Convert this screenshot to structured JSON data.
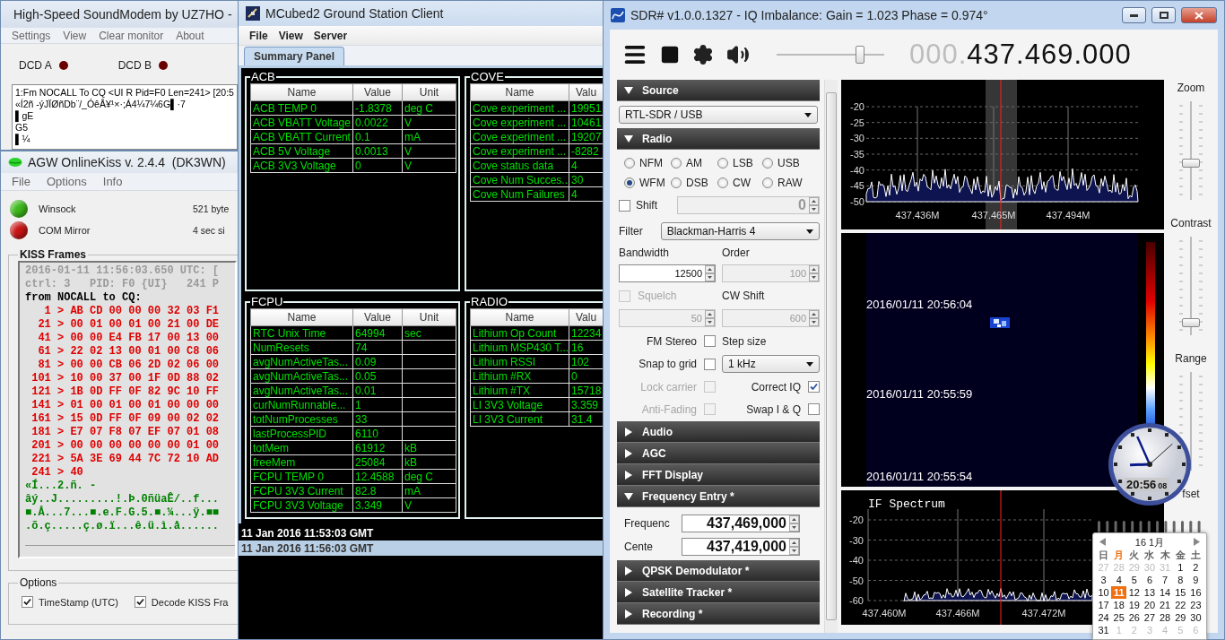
{
  "sound_modem": {
    "title": "High-Speed SoundModem by UZ7HO -",
    "menu": [
      "Settings",
      "View",
      "Clear monitor",
      "About"
    ],
    "dcd": [
      {
        "label": "DCD A",
        "on": false
      },
      {
        "label": "DCD B",
        "on": false
      }
    ],
    "monitor_lines": [
      "1:Fm NOCALL To CQ <UI R Pid=F0 Len=241> [20:5",
      "«Í2ñ -ýJÏØñDb¨/_ÓêÅ¥¹×·;Á4¼7¼6G▌·7",
      "▌gE",
      "G5",
      "▌¼"
    ]
  },
  "online_kiss": {
    "title": "AGW OnlineKiss v. 2.4.4  (DK3WN)",
    "menu": [
      "File",
      "Options",
      "Info"
    ],
    "status": [
      {
        "label": "Winsock",
        "color": "#3cb81a",
        "info": "521 byte"
      },
      {
        "label": "COM Mirror",
        "color": "#c81414",
        "info": "4 sec si"
      }
    ],
    "kiss_frames": {
      "title": "KISS Frames",
      "lines": [
        {
          "kind": "meta",
          "text": "2016-01-11 11:56:03.650 UTC: ["
        },
        {
          "kind": "meta",
          "text": "ctrl: 3   PID: F0 {UI}   241 P"
        },
        {
          "kind": "from",
          "text": "from NOCALL to CQ:"
        },
        {
          "kind": "hex",
          "text": "   1 > AB CD 00 00 00 32 03 F1"
        },
        {
          "kind": "hex",
          "text": "  21 > 00 01 00 01 00 21 00 DE"
        },
        {
          "kind": "hex",
          "text": "  41 > 00 00 E4 FB 17 00 13 00"
        },
        {
          "kind": "hex",
          "text": "  61 > 22 02 13 00 01 00 C8 06"
        },
        {
          "kind": "hex",
          "text": "  81 > 00 00 CB 06 2D 02 06 00"
        },
        {
          "kind": "hex",
          "text": " 101 > 10 00 37 00 1F 0D 88 02"
        },
        {
          "kind": "hex",
          "text": " 121 > 1B 0D FF 0F 82 9C 10 FF"
        },
        {
          "kind": "hex",
          "text": " 141 > 01 00 01 00 01 00 00 00"
        },
        {
          "kind": "hex",
          "text": " 161 > 15 0D FF 0F 09 00 02 02"
        },
        {
          "kind": "hex",
          "text": " 181 > E7 07 F8 07 EF 07 01 08"
        },
        {
          "kind": "hex",
          "text": " 201 > 00 00 00 00 00 00 01 00"
        },
        {
          "kind": "hex",
          "text": " 221 > 5A 3E 69 44 7C 72 10 AD"
        },
        {
          "kind": "hex",
          "text": " 241 > 40"
        },
        {
          "kind": "ascii",
          "text": "«Í...2.ñ. -"
        },
        {
          "kind": "ascii",
          "text": "âý..J.........!.Þ.0ñüaÊ/..f..."
        },
        {
          "kind": "ascii",
          "text": "■.Å...7...■.e.F.G.5.■.¼...ÿ.■■"
        },
        {
          "kind": "ascii",
          "text": ".õ.ç.....ç.ø.ï...ê.ü.ì.å......"
        }
      ]
    },
    "options": {
      "title": "Options",
      "checkboxes": [
        {
          "label": "TimeStamp (UTC)",
          "checked": true
        },
        {
          "label": "Decode KISS Fra",
          "checked": true
        }
      ]
    }
  },
  "mcubed": {
    "title": "MCubed2 Ground Station Client",
    "menu": [
      "File",
      "View",
      "Server"
    ],
    "tabs": [
      {
        "label": "Summary Panel",
        "selected": true
      }
    ],
    "panels": [
      {
        "title": "ACB",
        "columns": [
          "Name",
          "Value",
          "Unit"
        ],
        "rows": [
          {
            "name": "ACB TEMP 0",
            "value": "-1.8378",
            "unit": "deg C"
          },
          {
            "name": "ACB VBATT Voltage",
            "value": "0.0022",
            "unit": "V"
          },
          {
            "name": "ACB VBATT Current",
            "value": "0.1",
            "unit": "mA"
          },
          {
            "name": "ACB 5V Voltage",
            "value": "0.0013",
            "unit": "V"
          },
          {
            "name": "ACB 3V3 Voltage",
            "value": "0",
            "unit": "V"
          }
        ]
      },
      {
        "title": "COVE",
        "columns": [
          "Name",
          "Valu"
        ],
        "rows": [
          {
            "name": "Cove experiment ...",
            "value": "19951"
          },
          {
            "name": "Cove experiment ...",
            "value": "10461"
          },
          {
            "name": "Cove experiment ...",
            "value": "19207"
          },
          {
            "name": "Cove experiment ...",
            "value": "-8282"
          },
          {
            "name": "Cove status data",
            "value": "4"
          },
          {
            "name": "Cove Num Succes...",
            "value": "30"
          },
          {
            "name": "Cove Num Failures",
            "value": "4"
          }
        ]
      },
      {
        "title": "FCPU",
        "columns": [
          "Name",
          "Value",
          "Unit"
        ],
        "rows": [
          {
            "name": "RTC Unix Time",
            "value": "64994",
            "unit": "sec"
          },
          {
            "name": "NumResets",
            "value": "74"
          },
          {
            "name": "avgNumActiveTas...",
            "value": "0.09"
          },
          {
            "name": "avgNumActiveTas...",
            "value": "0.05"
          },
          {
            "name": "avgNumActiveTas...",
            "value": "0.01"
          },
          {
            "name": "curNumRunnable...",
            "value": "1"
          },
          {
            "name": "totNumProcesses",
            "value": "33"
          },
          {
            "name": "lastProcessPID",
            "value": "6110"
          },
          {
            "name": "totMem",
            "value": "61912",
            "unit": "kB"
          },
          {
            "name": "freeMem",
            "value": "25084",
            "unit": "kB"
          },
          {
            "name": "FCPU TEMP 0",
            "value": "12.4588",
            "unit": "deg C"
          },
          {
            "name": "FCPU 3V3 Current",
            "value": "82.8",
            "unit": "mA"
          },
          {
            "name": "FCPU 3V3 Voltage",
            "value": "3.349",
            "unit": "V"
          }
        ]
      },
      {
        "title": "RADIO",
        "columns": [
          "Name",
          "Valu"
        ],
        "rows": [
          {
            "name": "Lithium Op Count",
            "value": "12234"
          },
          {
            "name": "Lithium MSP430 T...",
            "value": "16"
          },
          {
            "name": "Lithium RSSI",
            "value": "102"
          },
          {
            "name": "Lithium #RX",
            "value": "0"
          },
          {
            "name": "Lithium #TX",
            "value": "15718"
          },
          {
            "name": "LI 3V3 Voltage",
            "value": "3.359"
          },
          {
            "name": "LI 3V3 Current",
            "value": "31.4"
          }
        ]
      }
    ],
    "log": [
      {
        "text": "11 Jan 2016 11:53:03 GMT",
        "selected": false
      },
      {
        "text": "11 Jan 2016 11:56:03 GMT",
        "selected": true
      }
    ]
  },
  "sdr": {
    "title": "SDR# v1.0.0.1327 - IQ Imbalance: Gain = 1.023 Phase = 0.974°",
    "volume": {
      "level": 0.8
    },
    "frequency_prefix": "000.",
    "frequency": "437.469.000",
    "sections": [
      {
        "kind": "source",
        "title": "Source",
        "expanded": true,
        "device": "RTL-SDR / USB"
      },
      {
        "kind": "radio",
        "title": "Radio",
        "expanded": true,
        "modes": [
          {
            "label": "NFM",
            "selected": false
          },
          {
            "label": "AM",
            "selected": false
          },
          {
            "label": "LSB",
            "selected": false
          },
          {
            "label": "USB",
            "selected": false
          },
          {
            "label": "WFM",
            "selected": true
          },
          {
            "label": "DSB",
            "selected": false
          },
          {
            "label": "CW",
            "selected": false
          },
          {
            "label": "RAW",
            "selected": false
          }
        ],
        "shift": {
          "label": "Shift",
          "checked": false,
          "value": "0",
          "disabled": true
        },
        "filter": {
          "label": "Filter",
          "value": "Blackman-Harris 4"
        },
        "bandwidth": {
          "label": "Bandwidth",
          "value": "12500",
          "disabled": false
        },
        "order": {
          "label": "Order",
          "value": "100",
          "disabled": true
        },
        "squelch": {
          "label": "Squelch",
          "checked": false,
          "disabled": true,
          "value": "50"
        },
        "cw_shift": {
          "label": "CW Shift",
          "value": "600",
          "disabled": true
        },
        "fm_stereo": {
          "label": "FM Stereo",
          "checked": false,
          "disabled": false
        },
        "step_size": {
          "label": "Step size",
          "value": "1 kHz"
        },
        "snap_to_grid": {
          "label": "Snap to grid",
          "checked": false,
          "disabled": false
        },
        "lock_carrier": {
          "label": "Lock carrier",
          "checked": false,
          "disabled": true
        },
        "correct_iq": {
          "label": "Correct IQ",
          "checked": true,
          "disabled": false
        },
        "anti_fading": {
          "label": "Anti-Fading",
          "checked": false,
          "disabled": true
        },
        "swap_iq": {
          "label": "Swap I & Q",
          "checked": false,
          "disabled": false
        }
      },
      {
        "title": "Audio",
        "expanded": false
      },
      {
        "title": "AGC",
        "expanded": false
      },
      {
        "title": "FFT Display",
        "expanded": false
      },
      {
        "kind": "frequency_entry",
        "title": "Frequency Entry *",
        "expanded": true,
        "fields": [
          {
            "label": "Frequenc",
            "value": "437,469,000"
          },
          {
            "label": "Cente",
            "value": "437,419,000"
          }
        ]
      },
      {
        "title": "QPSK Demodulator *",
        "expanded": false
      },
      {
        "title": "Satellite Tracker *",
        "expanded": false
      },
      {
        "title": "Recording *",
        "expanded": false
      }
    ],
    "spectrum": {
      "yticks": [
        "-20",
        "-25",
        "-30",
        "-35",
        "-40",
        "-45",
        "-50"
      ],
      "xticks": [
        "437.436M",
        "437.465M",
        "437.494M"
      ]
    },
    "waterfall": {
      "timestamps": [
        "2016/01/11 20:56:04",
        "2016/01/11 20:55:59",
        "2016/01/11 20:55:54"
      ]
    },
    "if_spectrum": {
      "title": "IF Spectrum",
      "yticks": [
        "-20",
        "-30",
        "-40",
        "-50",
        "-60"
      ],
      "xticks": [
        "437.460M",
        "437.466M",
        "437.472M"
      ]
    },
    "side_sliders": [
      {
        "kind": "slider",
        "label": "Zoom",
        "level": 0.36
      },
      {
        "kind": "slider",
        "label": "Contrast",
        "level": 0.09
      },
      {
        "kind": "track",
        "label": "Range"
      },
      {
        "kind": "caption",
        "label": "fset"
      }
    ]
  },
  "clock": {
    "time": "20:56",
    "seconds": "08"
  },
  "calendar": {
    "month": "16 1月",
    "weekdays": [
      {
        "label": "日",
        "today": false
      },
      {
        "label": "月",
        "today": true
      },
      {
        "label": "火",
        "today": false
      },
      {
        "label": "水",
        "today": false
      },
      {
        "label": "木",
        "today": false
      },
      {
        "label": "金",
        "today": false
      },
      {
        "label": "土",
        "today": false
      }
    ],
    "weeks": [
      [
        {
          "day": "27",
          "muted": true,
          "selected": false
        },
        {
          "day": "28",
          "muted": true,
          "selected": false
        },
        {
          "day": "29",
          "muted": true,
          "selected": false
        },
        {
          "day": "30",
          "muted": true,
          "selected": false
        },
        {
          "day": "31",
          "muted": true,
          "selected": false
        },
        {
          "day": "1",
          "muted": false,
          "selected": false
        },
        {
          "day": "2",
          "muted": false,
          "selected": false
        }
      ],
      [
        {
          "day": "3",
          "muted": false,
          "selected": false
        },
        {
          "day": "4",
          "muted": false,
          "selected": false
        },
        {
          "day": "5",
          "muted": false,
          "selected": false
        },
        {
          "day": "6",
          "muted": false,
          "selected": false
        },
        {
          "day": "7",
          "muted": false,
          "selected": false
        },
        {
          "day": "8",
          "muted": false,
          "selected": false
        },
        {
          "day": "9",
          "muted": false,
          "selected": false
        }
      ],
      [
        {
          "day": "10",
          "muted": false,
          "selected": false
        },
        {
          "day": "11",
          "muted": false,
          "selected": true
        },
        {
          "day": "12",
          "muted": false,
          "selected": false
        },
        {
          "day": "13",
          "muted": false,
          "selected": false
        },
        {
          "day": "14",
          "muted": false,
          "selected": false
        },
        {
          "day": "15",
          "muted": false,
          "selected": false
        },
        {
          "day": "16",
          "muted": false,
          "selected": false
        }
      ],
      [
        {
          "day": "17",
          "muted": false,
          "selected": false
        },
        {
          "day": "18",
          "muted": false,
          "selected": false
        },
        {
          "day": "19",
          "muted": false,
          "selected": false
        },
        {
          "day": "20",
          "muted": false,
          "selected": false
        },
        {
          "day": "21",
          "muted": false,
          "selected": false
        },
        {
          "day": "22",
          "muted": false,
          "selected": false
        },
        {
          "day": "23",
          "muted": false,
          "selected": false
        }
      ],
      [
        {
          "day": "24",
          "muted": false,
          "selected": false
        },
        {
          "day": "25",
          "muted": false,
          "selected": false
        },
        {
          "day": "26",
          "muted": false,
          "selected": false
        },
        {
          "day": "27",
          "muted": false,
          "selected": false
        },
        {
          "day": "28",
          "muted": false,
          "selected": false
        },
        {
          "day": "29",
          "muted": false,
          "selected": false
        },
        {
          "day": "30",
          "muted": false,
          "selected": false
        }
      ],
      [
        {
          "day": "31",
          "muted": false,
          "selected": false
        },
        {
          "day": "1",
          "muted": true,
          "selected": false
        },
        {
          "day": "2",
          "muted": true,
          "selected": false
        },
        {
          "day": "3",
          "muted": true,
          "selected": false
        },
        {
          "day": "4",
          "muted": true,
          "selected": false
        },
        {
          "day": "5",
          "muted": true,
          "selected": false
        },
        {
          "day": "6",
          "muted": true,
          "selected": false
        }
      ]
    ]
  }
}
